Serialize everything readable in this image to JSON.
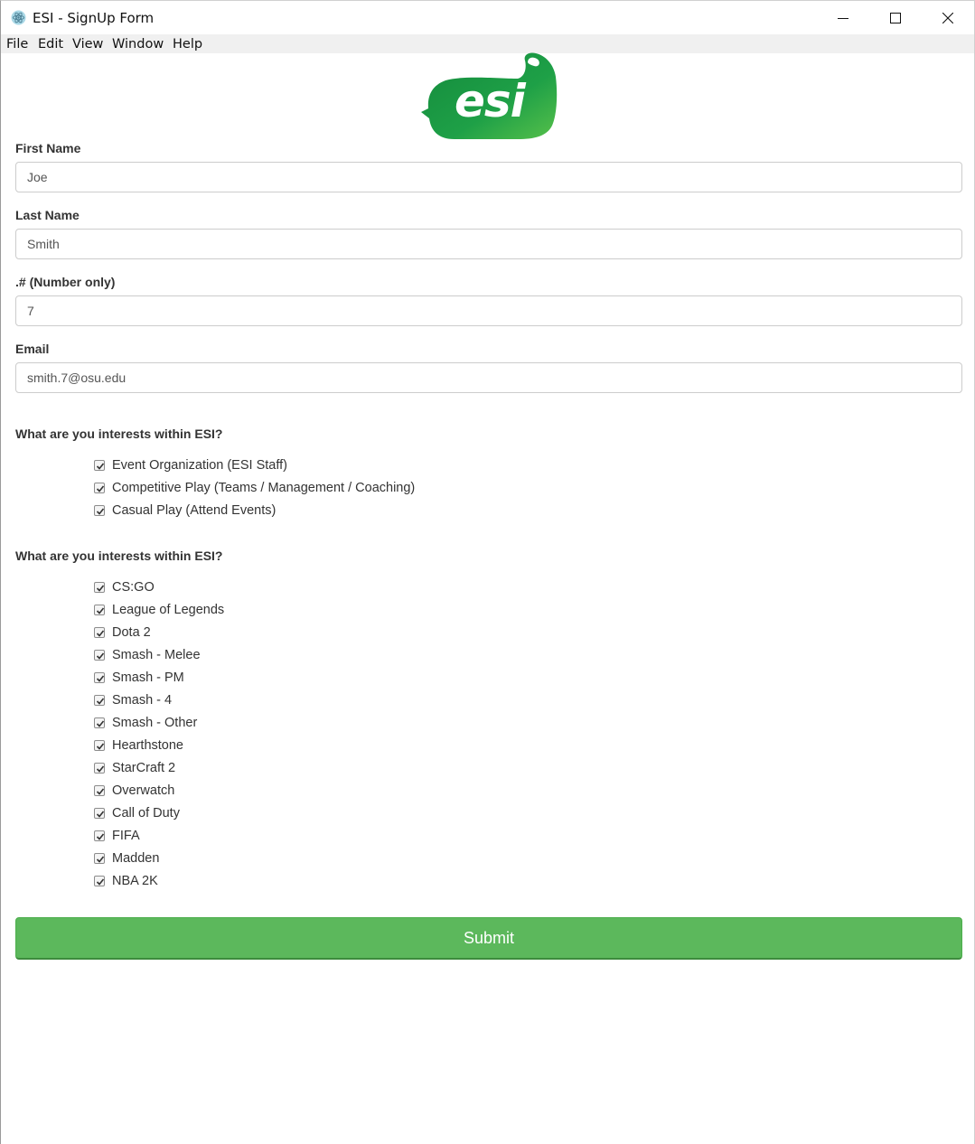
{
  "window": {
    "title": "ESI - SignUp Form",
    "icon": "electron-atom-icon"
  },
  "menu": [
    "File",
    "Edit",
    "View",
    "Window",
    "Help"
  ],
  "logo": {
    "text": "esi",
    "colors": {
      "primary": "#1e9a44",
      "highlight": "#5cc24a"
    }
  },
  "form": {
    "first_name": {
      "label": "First Name",
      "value": "Joe"
    },
    "last_name": {
      "label": "Last Name",
      "value": "Smith"
    },
    "number": {
      "label": ".# (Number only)",
      "value": "7"
    },
    "email": {
      "label": "Email",
      "value": "smith.7@osu.edu"
    }
  },
  "interests": {
    "title": "What are you interests within ESI?",
    "options": [
      {
        "label": "Event Organization (ESI Staff)",
        "checked": true
      },
      {
        "label": "Competitive Play (Teams / Management / Coaching)",
        "checked": true
      },
      {
        "label": "Casual Play (Attend Events)",
        "checked": true
      }
    ]
  },
  "games": {
    "title": "What are you interests within ESI?",
    "options": [
      {
        "label": "CS:GO",
        "checked": true
      },
      {
        "label": "League of Legends",
        "checked": true
      },
      {
        "label": "Dota 2",
        "checked": true
      },
      {
        "label": "Smash - Melee",
        "checked": true
      },
      {
        "label": "Smash - PM",
        "checked": true
      },
      {
        "label": "Smash - 4",
        "checked": true
      },
      {
        "label": "Smash - Other",
        "checked": true
      },
      {
        "label": "Hearthstone",
        "checked": true
      },
      {
        "label": "StarCraft 2",
        "checked": true
      },
      {
        "label": "Overwatch",
        "checked": true
      },
      {
        "label": "Call of Duty",
        "checked": true
      },
      {
        "label": "FIFA",
        "checked": true
      },
      {
        "label": "Madden",
        "checked": true
      },
      {
        "label": "NBA 2K",
        "checked": true
      }
    ]
  },
  "submit_label": "Submit",
  "colors": {
    "submit": "#5cb85c"
  }
}
